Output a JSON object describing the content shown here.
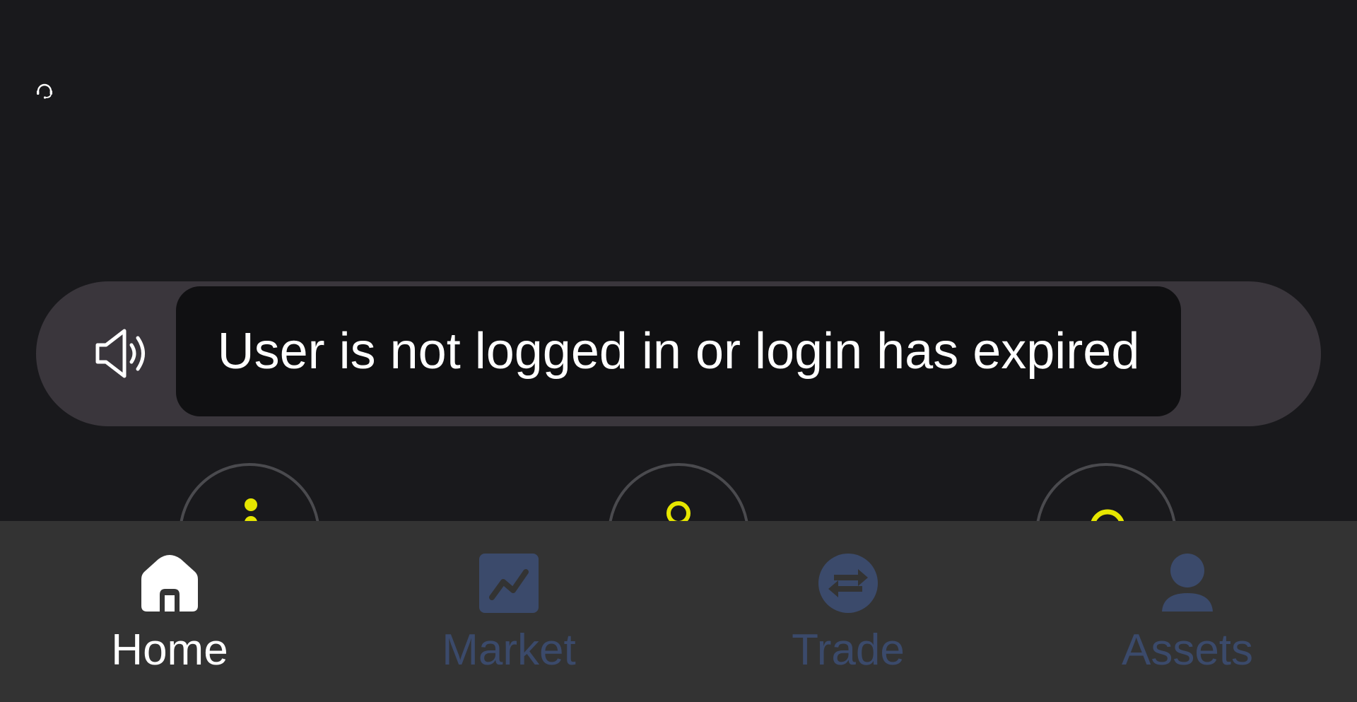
{
  "toast": {
    "message": "User is not logged in or login has expired"
  },
  "icons": {
    "support": "headset-icon",
    "notice": "speaker-icon"
  },
  "tabbar": {
    "active_index": 0,
    "tabs": [
      {
        "label": "Home",
        "icon": "home-icon"
      },
      {
        "label": "Market",
        "icon": "chart-icon"
      },
      {
        "label": "Trade",
        "icon": "exchange-icon"
      },
      {
        "label": "Assets",
        "icon": "user-icon"
      }
    ]
  },
  "colors": {
    "background": "#19191c",
    "notice_bar": "#3a363c",
    "toast": "#101012",
    "tabbar": "#333333",
    "tab_active": "#ffffff",
    "tab_inactive": "#3b4a6b",
    "accent_yellow": "#e6e600"
  }
}
